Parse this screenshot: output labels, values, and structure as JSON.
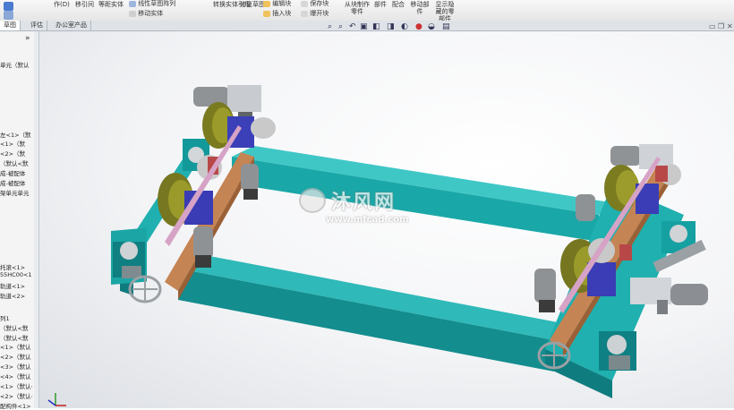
{
  "ribbon": {
    "items": [
      {
        "label": "作(D)"
      },
      {
        "label": "移引间"
      },
      {
        "label": "等距实体"
      },
      {
        "label": "线性草图阵列"
      },
      {
        "label": "移动实体"
      },
      {
        "label": "转换实体引用"
      },
      {
        "label": "修复草图"
      },
      {
        "label": "编辑块"
      },
      {
        "label": "插入块"
      },
      {
        "label": "保存块"
      },
      {
        "label": "爆开块"
      },
      {
        "label": "从块制作零件"
      },
      {
        "label": "部件"
      },
      {
        "label": "配合"
      },
      {
        "label": "移动部件"
      },
      {
        "label": "显示隐藏的零部件"
      }
    ]
  },
  "tabs": [
    {
      "label": "草图"
    },
    {
      "label": "评估"
    },
    {
      "label": "办公室产品"
    }
  ],
  "tree": {
    "collapse": "»",
    "items": [
      {
        "label": "单元（默认"
      },
      {
        "label": "左<1>（默"
      },
      {
        "label": "<1>（默"
      },
      {
        "label": "<2>（默"
      },
      {
        "label": "（默认<默"
      },
      {
        "label": "成-被配体"
      },
      {
        "label": "成-被配体"
      },
      {
        "label": "架单元单元"
      },
      {
        "label": "托滚<1>"
      },
      {
        "label": "55HC00<1>"
      },
      {
        "label": "轨道<1>"
      },
      {
        "label": "轨道<2>"
      },
      {
        "label": "列1"
      },
      {
        "label": "（默认<默"
      },
      {
        "label": "（默认<默"
      },
      {
        "label": "<1>（默认"
      },
      {
        "label": "<2>（默认"
      },
      {
        "label": "<3>（默认"
      },
      {
        "label": "<4>（默认"
      },
      {
        "label": "<1>（默认<"
      },
      {
        "label": "<2>（默认<"
      },
      {
        "label": "配构件<1>"
      }
    ]
  },
  "view_toolbar": {
    "icons": [
      "zoom-to-fit-icon",
      "zoom-area-icon",
      "previous-view-icon",
      "section-view-icon",
      "view-orientation-icon",
      "display-style-icon",
      "hide-show-icon",
      "appearance-icon",
      "scene-icon",
      "view-settings-icon"
    ]
  },
  "watermark": {
    "brand": "沐风网",
    "url": "www.mfcad.com"
  },
  "colors": {
    "frame": "#19a3a3",
    "frame_dark": "#0e6f73",
    "wood": "#c0824f",
    "blue": "#3a3db5",
    "wheel": "#7e7e1f"
  }
}
